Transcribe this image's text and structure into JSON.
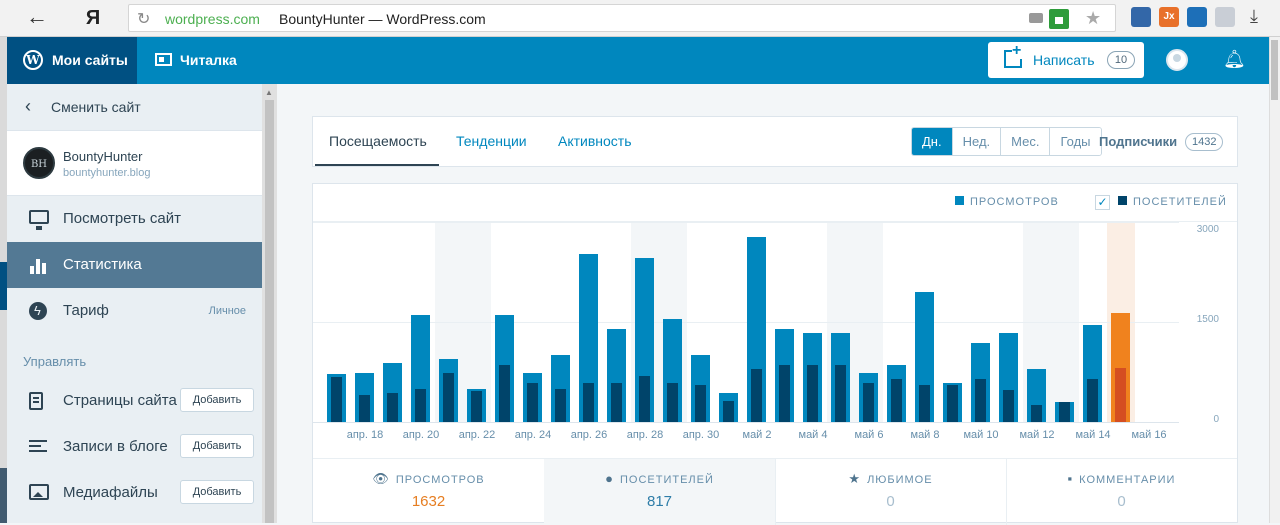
{
  "browser": {
    "back_glyph": "←",
    "yandex_glyph": "Я",
    "domain": "wordpress.com",
    "page_title": "BountyHunter — WordPress.com",
    "ext_label": "Jx"
  },
  "masterbar": {
    "my_sites": "Мои сайты",
    "reader": "Читалка",
    "write": "Написать",
    "drafts_count": "10",
    "wp_glyph": "W"
  },
  "sidebar": {
    "switch_site": "Сменить сайт",
    "site_name": "BountyHunter",
    "site_domain": "bountyhunter.blog",
    "site_avatar_text": "BH",
    "items": [
      {
        "label": "Посмотреть сайт",
        "icon": "monitor-icon"
      },
      {
        "label": "Статистика",
        "icon": "stats-icon",
        "active": true
      },
      {
        "label": "Тариф",
        "icon": "plan-icon",
        "tag": "Личное"
      }
    ],
    "manage_heading": "Управлять",
    "manage_items": [
      {
        "label": "Страницы сайта",
        "icon": "pages-icon",
        "button": "Добавить"
      },
      {
        "label": "Записи в блоге",
        "icon": "posts-icon",
        "button": "Добавить"
      },
      {
        "label": "Медиафайлы",
        "icon": "media-icon",
        "button": "Добавить"
      }
    ]
  },
  "stats": {
    "tabs": [
      "Посещаемость",
      "Тенденции",
      "Активность"
    ],
    "periods": [
      "Дн.",
      "Нед.",
      "Мес.",
      "Годы"
    ],
    "selected_period": "Дн.",
    "followers_label": "Подписчики",
    "followers_count": "1432",
    "legend_views": "ПРОСМОТРОВ",
    "legend_visitors": "ПОСЕТИТЕЛЕЙ",
    "summary": [
      {
        "label": "ПРОСМОТРОВ",
        "value": "1632",
        "icon": "eye-icon",
        "color": "#e67e22"
      },
      {
        "label": "ПОСЕТИТЕЛЕЙ",
        "value": "817",
        "icon": "user-icon",
        "color": "#2e7da8"
      },
      {
        "label": "ЛЮБИМОЕ",
        "value": "0",
        "icon": "star-icon",
        "color": "#a8bece"
      },
      {
        "label": "КОММЕНТАРИИ",
        "value": "0",
        "icon": "comment-icon",
        "color": "#a8bece"
      }
    ]
  },
  "chart_data": {
    "type": "bar",
    "categories": [
      "апр. 17",
      "апр. 18",
      "апр. 19",
      "апр. 20",
      "апр. 21",
      "апр. 22",
      "апр. 23",
      "апр. 24",
      "апр. 25",
      "апр. 26",
      "апр. 27",
      "апр. 28",
      "апр. 29",
      "апр. 30",
      "май 1",
      "май 2",
      "май 3",
      "май 4",
      "май 5",
      "май 6",
      "май 7",
      "май 8",
      "май 9",
      "май 10",
      "май 11",
      "май 12",
      "май 13",
      "май 14",
      "май 15",
      "май 16"
    ],
    "tick_labels": [
      "апр. 18",
      "апр. 20",
      "апр. 22",
      "апр. 24",
      "апр. 26",
      "апр. 28",
      "апр. 30",
      "май 2",
      "май 4",
      "май 6",
      "май 8",
      "май 10",
      "май 12",
      "май 14",
      "май 16"
    ],
    "series": [
      {
        "name": "ПРОСМОТРОВ",
        "values": [
          720,
          740,
          890,
          1610,
          950,
          490,
          1610,
          740,
          1010,
          2520,
          1400,
          2460,
          1550,
          1010,
          430,
          2770,
          1400,
          1340,
          1340,
          740,
          860,
          1950,
          590,
          1190,
          1340,
          800,
          300,
          1460,
          1632,
          0
        ]
      },
      {
        "name": "ПОСЕТИТЕЛЕЙ",
        "values": [
          680,
          400,
          440,
          490,
          740,
          460,
          850,
          590,
          490,
          590,
          590,
          690,
          590,
          550,
          320,
          800,
          850,
          850,
          850,
          590,
          640,
          550,
          550,
          640,
          480,
          260,
          300,
          650,
          817,
          0
        ]
      }
    ],
    "highlight_index": 28,
    "ylim": [
      0,
      3000
    ],
    "yticks": [
      "3000",
      "1500",
      "0"
    ],
    "grid": true,
    "colors": {
      "views": "#0087be",
      "visitors": "#00446a",
      "highlight_views": "#f0821e",
      "highlight_visitors": "#d54e21"
    }
  }
}
